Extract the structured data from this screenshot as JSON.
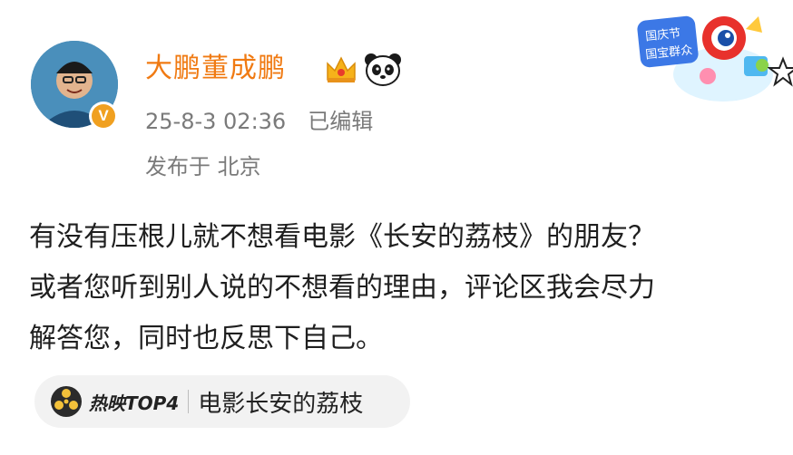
{
  "user": {
    "name": "大鹏董成鹏",
    "verified_badge": "V",
    "crown_icon": "crown-icon",
    "panda_icon": "panda-icon"
  },
  "meta": {
    "timestamp": "25-8-3 02:36",
    "edited": "已编辑",
    "location": "发布于 北京"
  },
  "post": {
    "lines": [
      "有没有压根儿就不想看电影《长安的荔枝》的朋友？",
      "或者您听到别人说的不想看的理由，评论区我会尽力",
      "解答您，同时也反思下自己。"
    ]
  },
  "topic": {
    "tag": "热映TOP4",
    "text": "电影长安的荔枝",
    "icon": "film-reel-icon"
  },
  "sticker": {
    "text": "国庆节 国宝群众",
    "icon": "mascot-sticker-icon"
  },
  "colors": {
    "username": "#f07a12",
    "meta": "#7a7a7a",
    "avatar_bg": "#3a7ea8",
    "badge": "#f0a020",
    "pill_bg": "#f2f2f2"
  }
}
